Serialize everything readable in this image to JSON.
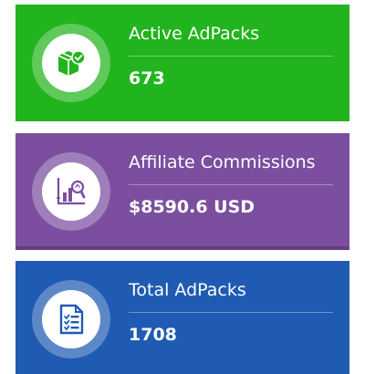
{
  "colors": {
    "green": "#22b41e",
    "purple": "#7b4ea0",
    "blue": "#1f5bb3"
  },
  "cards": [
    {
      "title": "Active AdPacks",
      "value": "673",
      "icon": "package-check-icon"
    },
    {
      "title": "Affiliate Commissions",
      "value": "$8590.6 USD",
      "icon": "chart-search-icon"
    },
    {
      "title": "Total AdPacks",
      "value": "1708",
      "icon": "document-list-icon"
    }
  ]
}
